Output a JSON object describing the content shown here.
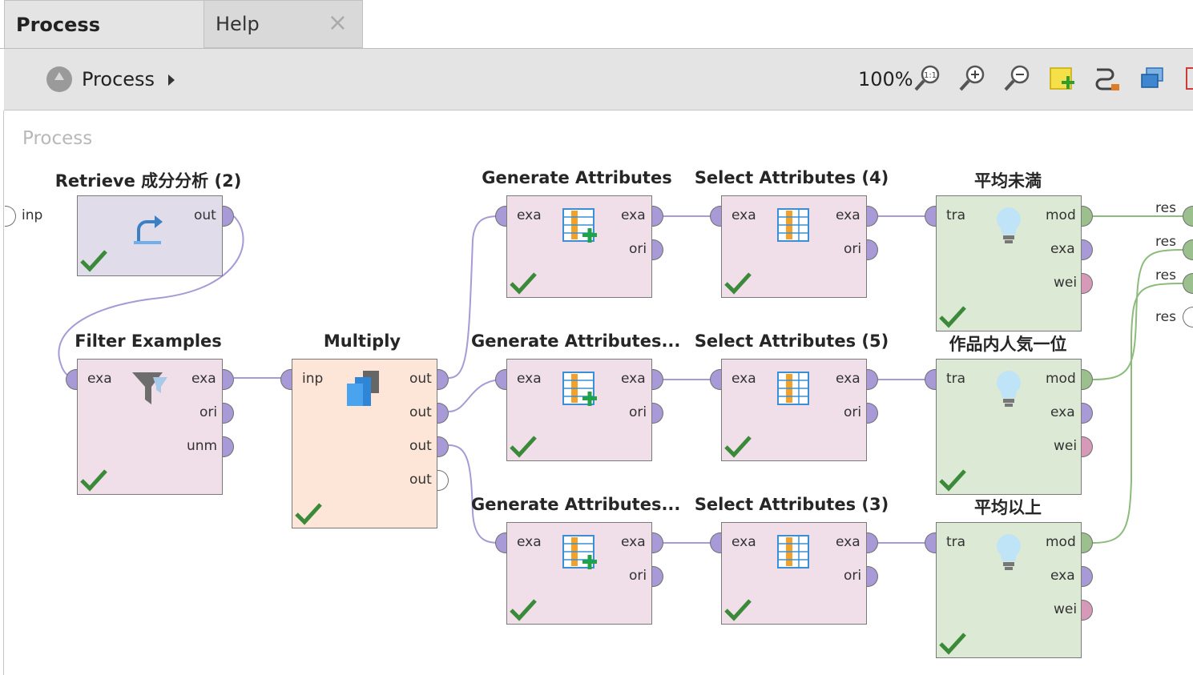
{
  "tabs": [
    {
      "label": "Process",
      "active": true
    },
    {
      "label": "Help",
      "close_icon": "×"
    }
  ],
  "toolbar": {
    "breadcrumb": "Process",
    "zoom": "100%",
    "tools": [
      "zoom-reset-icon",
      "zoom-in-icon",
      "zoom-out-icon",
      "add-note-icon",
      "auto-wire-icon",
      "layers-icon",
      "fit-icon"
    ]
  },
  "canvas": {
    "title": "Process"
  },
  "process_ports": {
    "input": "inp",
    "results": [
      "res",
      "res",
      "res",
      "res"
    ]
  },
  "operators": {
    "retrieve": {
      "title": "Retrieve 成分分析 (2)",
      "out": [
        "out"
      ]
    },
    "filter": {
      "title": "Filter Examples",
      "in": [
        "exa"
      ],
      "out": [
        "exa",
        "ori",
        "unm"
      ]
    },
    "multiply": {
      "title": "Multiply",
      "in": [
        "inp"
      ],
      "out": [
        "out",
        "out",
        "out",
        "out"
      ]
    },
    "gen1": {
      "title": "Generate Attributes",
      "in": [
        "exa"
      ],
      "out": [
        "exa",
        "ori"
      ]
    },
    "gen2": {
      "title": "Generate Attributes...",
      "in": [
        "exa"
      ],
      "out": [
        "exa",
        "ori"
      ]
    },
    "gen3": {
      "title": "Generate Attributes...",
      "in": [
        "exa"
      ],
      "out": [
        "exa",
        "ori"
      ]
    },
    "sel4": {
      "title": "Select Attributes (4)",
      "in": [
        "exa"
      ],
      "out": [
        "exa",
        "ori"
      ]
    },
    "sel5": {
      "title": "Select Attributes (5)",
      "in": [
        "exa"
      ],
      "out": [
        "exa",
        "ori"
      ]
    },
    "sel3": {
      "title": "Select Attributes (3)",
      "in": [
        "exa"
      ],
      "out": [
        "exa",
        "ori"
      ]
    },
    "model1": {
      "title": "平均未満",
      "in": [
        "tra"
      ],
      "out": [
        "mod",
        "exa",
        "wei"
      ]
    },
    "model2": {
      "title": "作品内人気一位",
      "in": [
        "tra"
      ],
      "out": [
        "mod",
        "exa",
        "wei"
      ]
    },
    "model3": {
      "title": "平均以上",
      "in": [
        "tra"
      ],
      "out": [
        "mod",
        "exa",
        "wei"
      ]
    }
  },
  "colors": {
    "wire_example": "#a89ad6",
    "wire_model": "#8cbb7c",
    "accent": "#3a8a3a"
  }
}
